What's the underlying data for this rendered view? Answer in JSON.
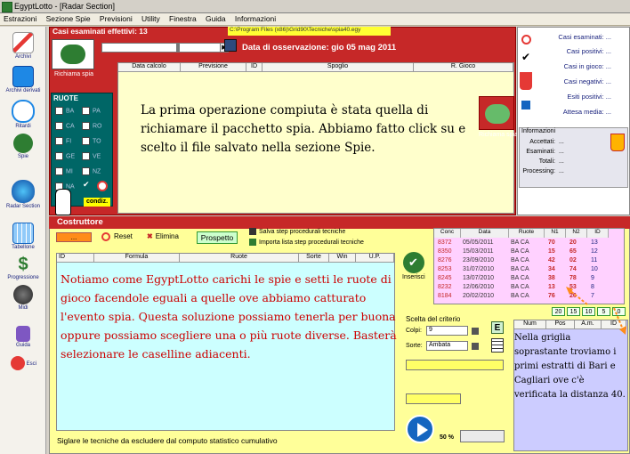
{
  "window": {
    "title": "EgyptLotto - [Radar Section]"
  },
  "menu": [
    "Estrazioni",
    "Sezione Spie",
    "Previsioni",
    "Utility",
    "Finestra",
    "Guida",
    "Informazioni"
  ],
  "sidebar": [
    "Archivi",
    "Archivi derivati",
    "Ritardi",
    "Spie",
    "Radar Section",
    "Tabellone",
    "Progressione",
    "Midi",
    "Guida",
    "Esci"
  ],
  "top": {
    "casi_label": "Casi esaminati effettivi: 13",
    "spy_button": "Richiama spia",
    "path": "C:\\Program Files (x86)\\Grid90\\Tecniche\\spia40.egy",
    "obs_date": "Data di osservazione:  gio 05 mag 2011",
    "columns": [
      "Data calcolo",
      "Previsione",
      "ID",
      "Spoglio",
      "R. Gioco"
    ],
    "ruote_title": "RUOTE",
    "ruote": [
      "BA",
      "PA",
      "CA",
      "RO",
      "FI",
      "TO",
      "GE",
      "VE",
      "MI",
      "NZ",
      "NA"
    ],
    "condiz": "condiz."
  },
  "narration": {
    "first": "La prima operazione compiuta è stata quella di richiamare il pacchetto spia. Abbiamo fatto click su e scelto il file salvato nella sezione Spie.",
    "second": "Notiamo come EgyptLotto carichi le spie e setti le ruote di gioco facendole eguali a quelle ove abbiamo catturato l'evento spia. Questa soluzione possiamo tenerla per buona oppure possiamo scegliere una o più ruote diverse. Basterà selezionare le caselline adiacenti.",
    "third": "Nella griglia soprastante troviamo i primi estratti di Bari e Cagliari ove c'è verificata la distanza 40."
  },
  "stats": {
    "items": [
      "Casi esaminati: ...",
      "Casi positivi: ...",
      "Casi in gioco: ...",
      "Casi negativi: ...",
      "Esiti positivi: ...",
      "Attesa media: ..."
    ],
    "spy_button2": "Richiama spia",
    "info_title": "Informazioni",
    "info_rows": [
      "Accettati:",
      "Esaminati:",
      "Totali:",
      "Processing:"
    ],
    "info_vals": [
      "...",
      "...",
      "...",
      "..."
    ]
  },
  "costruttore": {
    "title": "Costruttore",
    "dots": "...",
    "reset": "Reset",
    "elimina": "Elimina",
    "prospetto": "Prospetto",
    "save_step": "Salva step procedurali tecniche",
    "import_step": "Importa lista step procedurali tecniche",
    "columns": [
      "ID",
      "Formula",
      "Ruote",
      "Sorte",
      "Win",
      "U.P."
    ],
    "inserisci": "Inserisci",
    "footer": "Siglare le tecniche da escludere dal computo statistico cumulativo"
  },
  "draws": {
    "columns": [
      "Conc",
      "Data",
      "Ruote",
      "N1",
      "N2",
      "ID"
    ],
    "rows": [
      [
        "8372",
        "05/05/2011",
        "BA CA",
        "70",
        "20",
        "13"
      ],
      [
        "8350",
        "15/03/2011",
        "BA CA",
        "15",
        "65",
        "12"
      ],
      [
        "8276",
        "23/09/2010",
        "BA CA",
        "42",
        "02",
        "11"
      ],
      [
        "8253",
        "31/07/2010",
        "BA CA",
        "34",
        "74",
        "10"
      ],
      [
        "8245",
        "13/07/2010",
        "BA CA",
        "38",
        "78",
        "9"
      ],
      [
        "8232",
        "12/06/2010",
        "BA CA",
        "13",
        "53",
        "8"
      ],
      [
        "8184",
        "20/02/2010",
        "BA CA",
        "76",
        "26",
        "7"
      ]
    ],
    "counters": [
      "20",
      "15",
      "10",
      "5",
      "0"
    ]
  },
  "criteria": {
    "title": "Scelta del criterio",
    "colpi_label": "Colpi:",
    "colpi_value": "9",
    "sorte_label": "Sorte:",
    "sorte_value": "Ambata",
    "e_button": "E",
    "zoom": "50 %"
  },
  "grid": {
    "columns": [
      "Num",
      "Pos",
      "A.m.",
      "ID"
    ]
  },
  "colors": {
    "red_panel": "#c62828",
    "teal": "#006666",
    "yellow": "#ffff99"
  }
}
